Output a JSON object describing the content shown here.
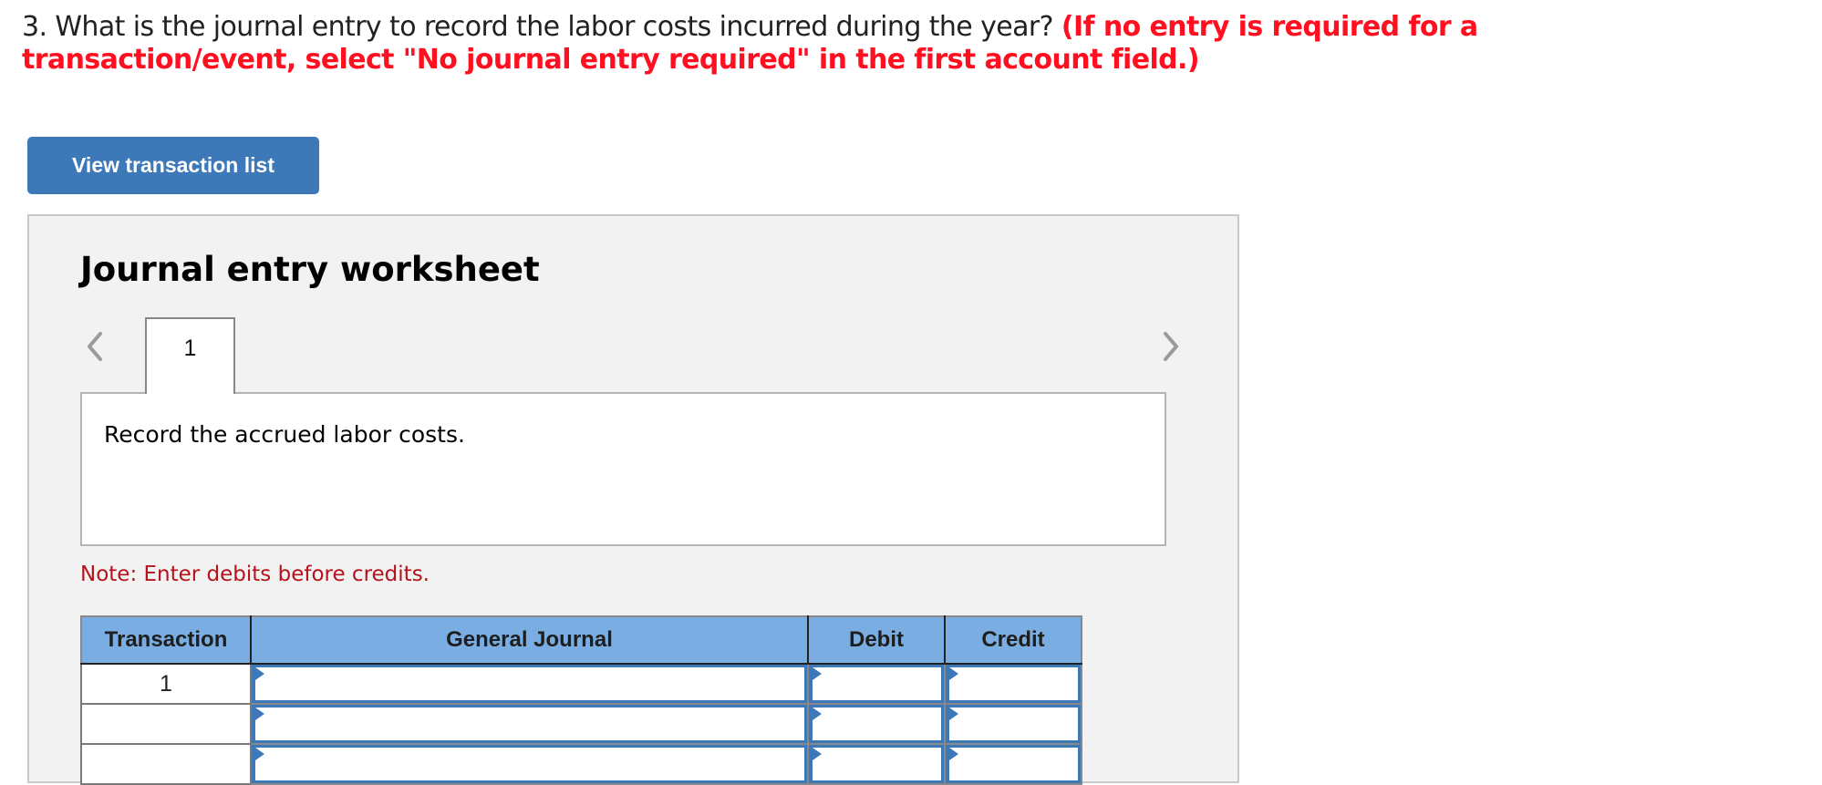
{
  "question": {
    "text": "3. What is the journal entry to record the labor costs incurred during the year?",
    "instruction": "(If no entry is required for a transaction/event, select \"No journal entry required\" in the first account field.)"
  },
  "buttons": {
    "view_transaction_list": "View transaction list"
  },
  "worksheet": {
    "title": "Journal entry worksheet",
    "tabs": [
      {
        "label": "1",
        "active": true
      }
    ],
    "description": "Record the accrued labor costs.",
    "note": "Note: Enter debits before credits.",
    "icons": {
      "prev": "chevron-left-icon",
      "next": "chevron-right-icon"
    }
  },
  "table": {
    "headers": [
      "Transaction",
      "General Journal",
      "Debit",
      "Credit"
    ],
    "rows": [
      {
        "transaction": "1",
        "account": "",
        "debit": "",
        "credit": ""
      },
      {
        "transaction": "",
        "account": "",
        "debit": "",
        "credit": ""
      },
      {
        "transaction": "",
        "account": "",
        "debit": "",
        "credit": ""
      }
    ]
  },
  "colors": {
    "button_bg": "#3d78b9",
    "instruction_red": "#ff0f1f",
    "note_red": "#b5121b",
    "header_blue": "#7aaee2",
    "panel_bg": "#f2f2f2"
  }
}
